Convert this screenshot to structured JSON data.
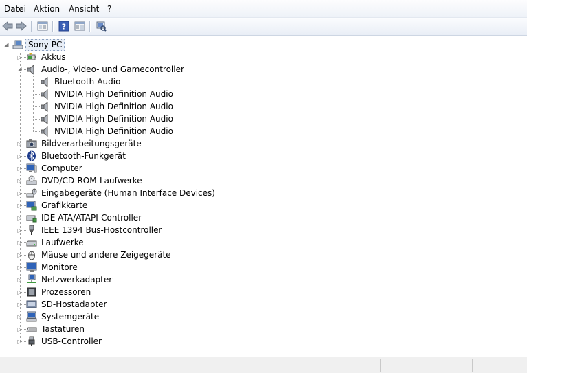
{
  "menubar": {
    "items": [
      "Datei",
      "Aktion",
      "Ansicht",
      "?"
    ]
  },
  "toolbar": {
    "buttons": [
      "back-icon",
      "forward-icon",
      "properties-icon",
      "help-icon",
      "show-hide-pane-icon",
      "scan-hardware-icon"
    ]
  },
  "tree": {
    "root": {
      "label": "Sony-PC",
      "icon": "computer-icon"
    },
    "categories": [
      {
        "label": "Akkus",
        "icon": "battery-icon",
        "expanded": false
      },
      {
        "label": "Audio-, Video- und Gamecontroller",
        "icon": "speaker-icon",
        "expanded": true,
        "children": [
          "Bluetooth-Audio",
          "NVIDIA High Definition Audio",
          "NVIDIA High Definition Audio",
          "NVIDIA High Definition Audio",
          "NVIDIA High Definition Audio"
        ]
      },
      {
        "label": "Bildverarbeitungsgeräte",
        "icon": "camera-icon",
        "expanded": false
      },
      {
        "label": "Bluetooth-Funkgerät",
        "icon": "bluetooth-icon",
        "expanded": false
      },
      {
        "label": "Computer",
        "icon": "monitor-icon",
        "expanded": false
      },
      {
        "label": "DVD/CD-ROM-Laufwerke",
        "icon": "disc-drive-icon",
        "expanded": false
      },
      {
        "label": "Eingabegeräte (Human Interface Devices)",
        "icon": "hid-icon",
        "expanded": false
      },
      {
        "label": "Grafikkarte",
        "icon": "display-adapter-icon",
        "expanded": false
      },
      {
        "label": "IDE ATA/ATAPI-Controller",
        "icon": "ide-controller-icon",
        "expanded": false
      },
      {
        "label": "IEEE 1394 Bus-Hostcontroller",
        "icon": "firewire-icon",
        "expanded": false
      },
      {
        "label": "Laufwerke",
        "icon": "hard-drive-icon",
        "expanded": false
      },
      {
        "label": "Mäuse und andere Zeigegeräte",
        "icon": "mouse-icon",
        "expanded": false
      },
      {
        "label": "Monitore",
        "icon": "monitor-icon",
        "expanded": false
      },
      {
        "label": "Netzwerkadapter",
        "icon": "network-adapter-icon",
        "expanded": false
      },
      {
        "label": "Prozessoren",
        "icon": "processor-icon",
        "expanded": false
      },
      {
        "label": "SD-Hostadapter",
        "icon": "sd-host-icon",
        "expanded": false
      },
      {
        "label": "Systemgeräte",
        "icon": "system-devices-icon",
        "expanded": false
      },
      {
        "label": "Tastaturen",
        "icon": "keyboard-icon",
        "expanded": false
      },
      {
        "label": "USB-Controller",
        "icon": "usb-icon",
        "expanded": false
      }
    ]
  }
}
